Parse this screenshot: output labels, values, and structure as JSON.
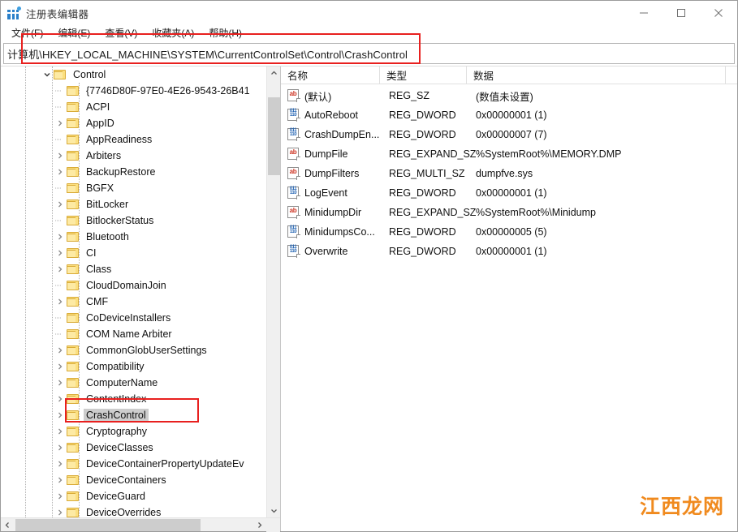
{
  "window": {
    "title": "注册表编辑器",
    "icon": "registry-editor-icon",
    "controls": {
      "minimize": "—",
      "maximize": "□",
      "close": "✕"
    }
  },
  "menubar": {
    "items": [
      {
        "label": "文件(F)"
      },
      {
        "label": "编辑(E)"
      },
      {
        "label": "查看(V)"
      },
      {
        "label": "收藏夹(A)"
      },
      {
        "label": "帮助(H)"
      }
    ]
  },
  "address": {
    "value": "计算机\\HKEY_LOCAL_MACHINE\\SYSTEM\\CurrentControlSet\\Control\\CrashControl",
    "placeholder": ""
  },
  "tree": {
    "rows": [
      {
        "label": "Control",
        "indent": 3,
        "expander": "expanded",
        "selected": false
      },
      {
        "label": "{7746D80F-97E0-4E26-9543-26B41",
        "indent": 4,
        "expander": "none",
        "selected": false
      },
      {
        "label": "ACPI",
        "indent": 4,
        "expander": "none",
        "selected": false
      },
      {
        "label": "AppID",
        "indent": 4,
        "expander": "collapsed",
        "selected": false
      },
      {
        "label": "AppReadiness",
        "indent": 4,
        "expander": "none",
        "selected": false
      },
      {
        "label": "Arbiters",
        "indent": 4,
        "expander": "collapsed",
        "selected": false
      },
      {
        "label": "BackupRestore",
        "indent": 4,
        "expander": "collapsed",
        "selected": false
      },
      {
        "label": "BGFX",
        "indent": 4,
        "expander": "none",
        "selected": false
      },
      {
        "label": "BitLocker",
        "indent": 4,
        "expander": "collapsed",
        "selected": false
      },
      {
        "label": "BitlockerStatus",
        "indent": 4,
        "expander": "none",
        "selected": false
      },
      {
        "label": "Bluetooth",
        "indent": 4,
        "expander": "collapsed",
        "selected": false
      },
      {
        "label": "CI",
        "indent": 4,
        "expander": "collapsed",
        "selected": false
      },
      {
        "label": "Class",
        "indent": 4,
        "expander": "collapsed",
        "selected": false
      },
      {
        "label": "CloudDomainJoin",
        "indent": 4,
        "expander": "none",
        "selected": false
      },
      {
        "label": "CMF",
        "indent": 4,
        "expander": "collapsed",
        "selected": false
      },
      {
        "label": "CoDeviceInstallers",
        "indent": 4,
        "expander": "none",
        "selected": false
      },
      {
        "label": "COM Name Arbiter",
        "indent": 4,
        "expander": "none",
        "selected": false
      },
      {
        "label": "CommonGlobUserSettings",
        "indent": 4,
        "expander": "collapsed",
        "selected": false
      },
      {
        "label": "Compatibility",
        "indent": 4,
        "expander": "collapsed",
        "selected": false
      },
      {
        "label": "ComputerName",
        "indent": 4,
        "expander": "collapsed",
        "selected": false
      },
      {
        "label": "ContentIndex",
        "indent": 4,
        "expander": "collapsed",
        "selected": false
      },
      {
        "label": "CrashControl",
        "indent": 4,
        "expander": "collapsed",
        "selected": true
      },
      {
        "label": "Cryptography",
        "indent": 4,
        "expander": "collapsed",
        "selected": false
      },
      {
        "label": "DeviceClasses",
        "indent": 4,
        "expander": "collapsed",
        "selected": false
      },
      {
        "label": "DeviceContainerPropertyUpdateEv",
        "indent": 4,
        "expander": "collapsed",
        "selected": false
      },
      {
        "label": "DeviceContainers",
        "indent": 4,
        "expander": "collapsed",
        "selected": false
      },
      {
        "label": "DeviceGuard",
        "indent": 4,
        "expander": "collapsed",
        "selected": false
      },
      {
        "label": "DeviceOverrides",
        "indent": 4,
        "expander": "collapsed",
        "selected": false
      }
    ]
  },
  "values": {
    "columns": {
      "name": "名称",
      "type": "类型",
      "data": "数据"
    },
    "rows": [
      {
        "icon": "string-value-icon",
        "name": "(默认)",
        "type": "REG_SZ",
        "data": "(数值未设置)"
      },
      {
        "icon": "dword-value-icon",
        "name": "AutoReboot",
        "type": "REG_DWORD",
        "data": "0x00000001 (1)"
      },
      {
        "icon": "dword-value-icon",
        "name": "CrashDumpEn...",
        "type": "REG_DWORD",
        "data": "0x00000007 (7)"
      },
      {
        "icon": "string-value-icon",
        "name": "DumpFile",
        "type": "REG_EXPAND_SZ",
        "data": "%SystemRoot%\\MEMORY.DMP"
      },
      {
        "icon": "string-value-icon",
        "name": "DumpFilters",
        "type": "REG_MULTI_SZ",
        "data": "dumpfve.sys"
      },
      {
        "icon": "dword-value-icon",
        "name": "LogEvent",
        "type": "REG_DWORD",
        "data": "0x00000001 (1)"
      },
      {
        "icon": "string-value-icon",
        "name": "MinidumpDir",
        "type": "REG_EXPAND_SZ",
        "data": "%SystemRoot%\\Minidump"
      },
      {
        "icon": "dword-value-icon",
        "name": "MinidumpsCo...",
        "type": "REG_DWORD",
        "data": "0x00000005 (5)"
      },
      {
        "icon": "dword-value-icon",
        "name": "Overwrite",
        "type": "REG_DWORD",
        "data": "0x00000001 (1)"
      }
    ]
  },
  "watermark": {
    "text": "江西龙网",
    "color": "#f08a1e"
  },
  "annotations": {
    "address_highlight": "red-rectangle-address-bar",
    "crashcontrol_highlight": "red-rectangle-crashcontrol"
  }
}
